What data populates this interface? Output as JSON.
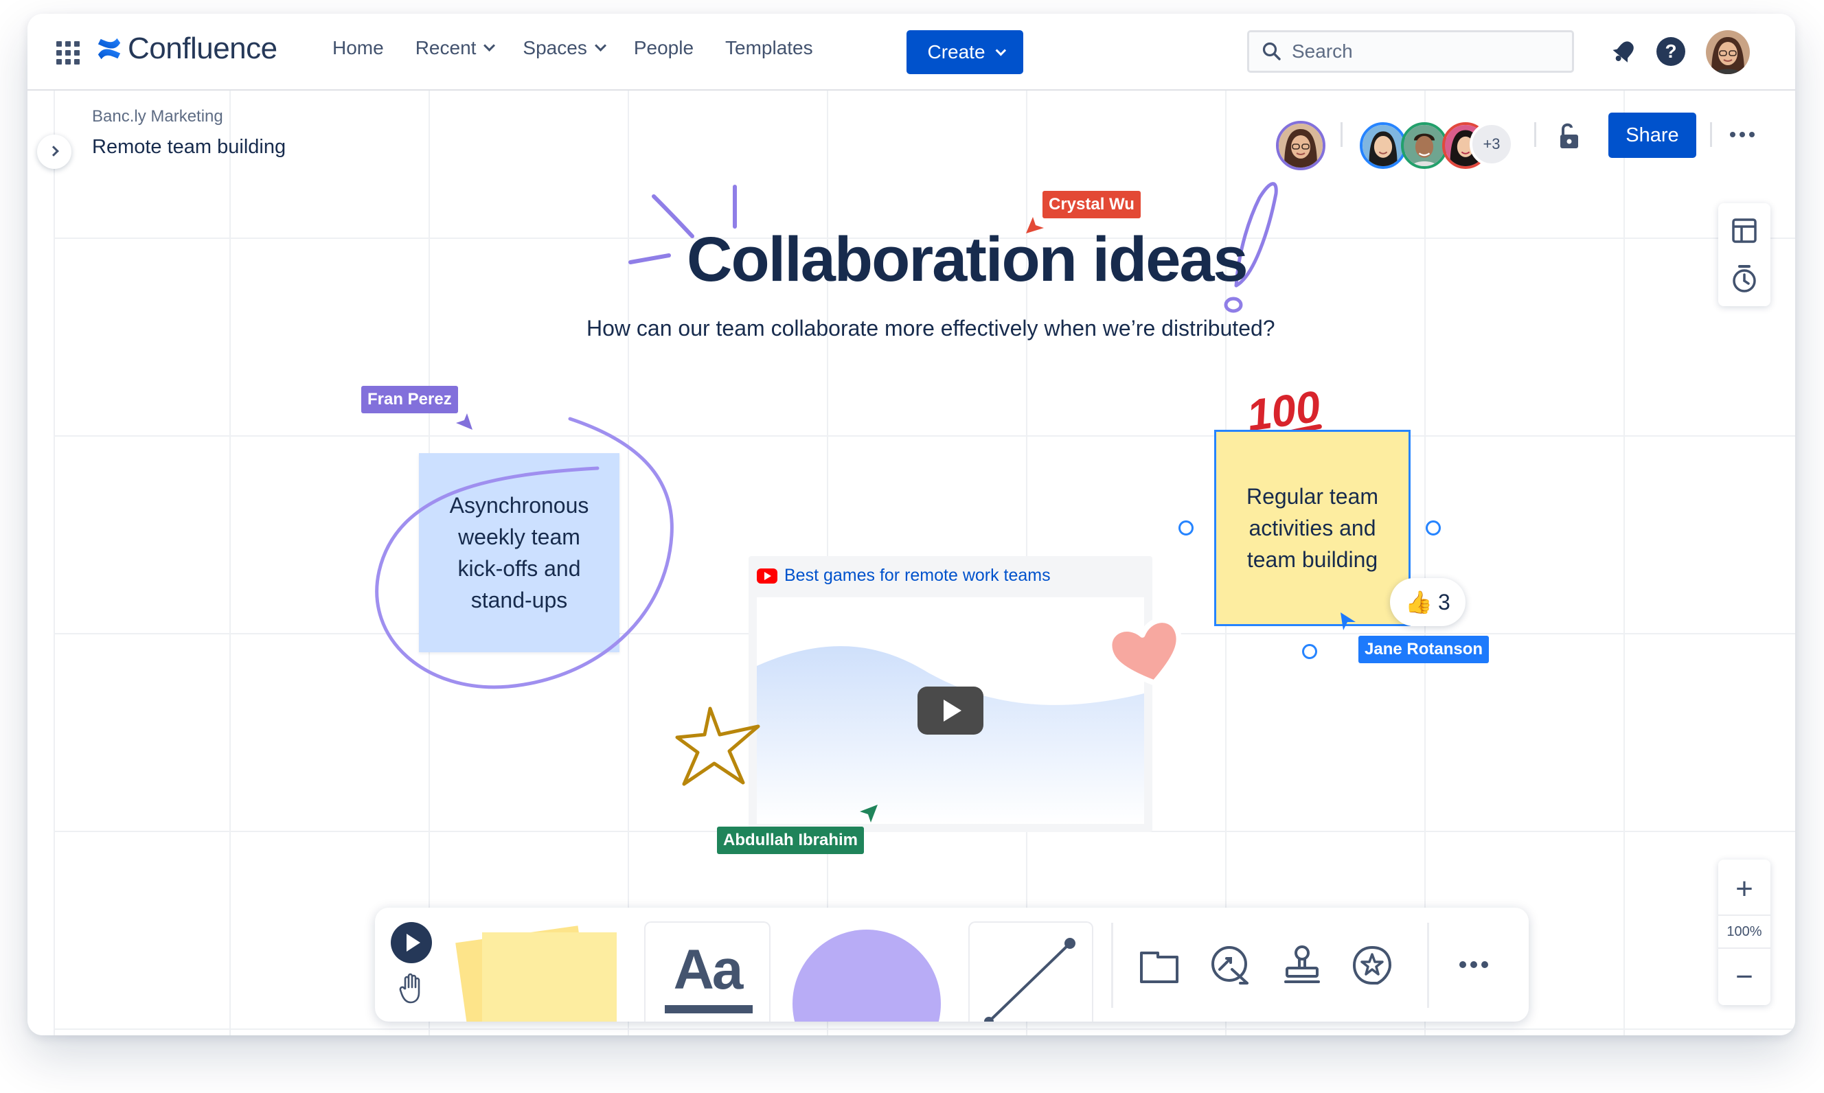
{
  "app": {
    "name": "Confluence"
  },
  "nav": {
    "items": [
      {
        "label": "Home",
        "has_dropdown": false
      },
      {
        "label": "Recent",
        "has_dropdown": true
      },
      {
        "label": "Spaces",
        "has_dropdown": true
      },
      {
        "label": "People",
        "has_dropdown": false
      },
      {
        "label": "Templates",
        "has_dropdown": false
      }
    ],
    "create_label": "Create",
    "search_placeholder": "Search"
  },
  "breadcrumb": {
    "space": "Banc.ly Marketing",
    "page": "Remote team building"
  },
  "presence": {
    "more_count": "+3"
  },
  "share_label": "Share",
  "board": {
    "title": "Collaboration ideas",
    "subtitle": "How can our team collaborate more effectively when we’re distributed?"
  },
  "cursors": [
    {
      "name": "Crystal Wu",
      "color": "#e34935"
    },
    {
      "name": "Fran Perez",
      "color": "#8270db"
    },
    {
      "name": "Jane Rotanson",
      "color": "#1d7afc"
    },
    {
      "name": "Abdullah Ibrahim",
      "color": "#1f845a"
    }
  ],
  "stickies": {
    "blue_text": "Asynchronous weekly team kick-offs and stand-ups",
    "yellow_text": "Regular team activities and team building"
  },
  "reaction": {
    "emoji": "👍",
    "count": "3"
  },
  "video": {
    "title": "Best games for remote work teams"
  },
  "zoom": {
    "level": "100%"
  },
  "toolbar": {
    "text_tool_label": "Aa"
  },
  "icons": [
    "apps-grid-icon",
    "confluence-logo-icon",
    "search-icon",
    "notification-icon",
    "help-icon",
    "chevron-right-icon",
    "unlock-icon",
    "more-icon",
    "template-icon",
    "timer-icon",
    "zoom-in-icon",
    "zoom-out-icon",
    "play-icon",
    "hand-icon",
    "sticky-note-icon",
    "shape-icon",
    "line-icon",
    "frame-icon",
    "smart-connector-icon",
    "stamp-icon",
    "sticker-icon",
    "youtube-icon",
    "star-sticker-icon",
    "heart-sticker-icon",
    "hundred-emoji-icon"
  ],
  "colors": {
    "brand_blue": "#0052cc",
    "sticky_blue": "#cce0ff",
    "sticky_yellow": "#fdeda0",
    "shape_purple": "#b8acf6",
    "doodle_purple": "#9f8fef"
  }
}
